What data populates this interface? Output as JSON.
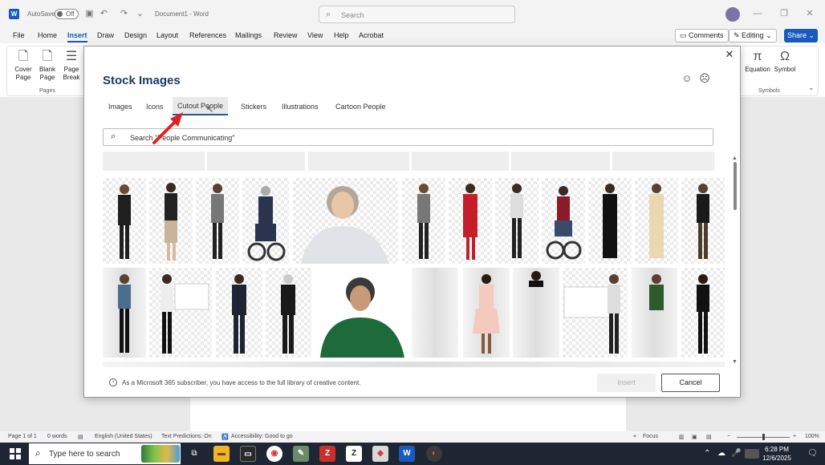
{
  "titlebar": {
    "autosave_label": "AutoSave",
    "autosave_state": "Off",
    "doc_title": "Document1 - Word",
    "search_placeholder": "Search"
  },
  "ribbon": {
    "tabs": [
      "File",
      "Home",
      "Insert",
      "Draw",
      "Design",
      "Layout",
      "References",
      "Mailings",
      "Review",
      "View",
      "Help",
      "Acrobat"
    ],
    "active_tab": "Insert",
    "comments_label": "Comments",
    "editing_label": "Editing",
    "share_label": "Share",
    "pages_group": {
      "label": "Pages",
      "items": [
        "Cover Page",
        "Blank Page",
        "Page Break"
      ]
    },
    "symbols_group": {
      "label": "Symbols",
      "items": [
        "Equation",
        "Symbol"
      ]
    }
  },
  "dialog": {
    "title": "Stock Images",
    "tabs": [
      "Images",
      "Icons",
      "Cutout People",
      "Stickers",
      "Illustrations",
      "Cartoon People"
    ],
    "active_tab": "Cutout People",
    "search_value": "Search \"People Communicating\"",
    "footer_text": "As a Microsoft 365 subscriber, you have access to the full library of creative content.",
    "insert_label": "Insert",
    "cancel_label": "Cancel",
    "accent_color": "#2b579a"
  },
  "statusbar": {
    "page": "Page 1 of 1",
    "words": "0 words",
    "language": "English (United States)",
    "predictions": "Text Predictions: On",
    "accessibility": "Accessibility: Good to go",
    "focus": "Focus",
    "zoom": "100%"
  },
  "taskbar": {
    "search_placeholder": "Type here to search",
    "time": "6:28 PM",
    "date": "12/6/2025"
  }
}
